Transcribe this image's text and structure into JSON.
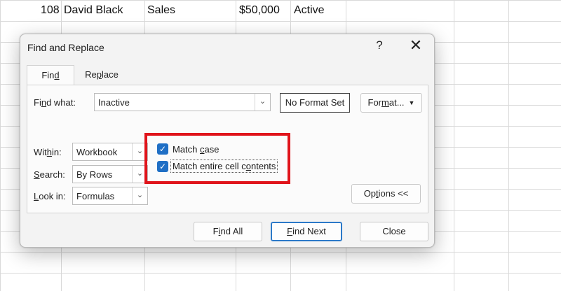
{
  "spreadsheet": {
    "row": {
      "id": "108",
      "name": "David Black",
      "department": "Sales",
      "salary": "$50,000",
      "status": "Active"
    }
  },
  "dialog": {
    "title": "Find and Replace",
    "help_label": "?",
    "close_label": "✕",
    "tabs": {
      "find": {
        "before": "Fin",
        "underline": "d",
        "after": ""
      },
      "replace": {
        "before": "Re",
        "underline": "p",
        "after": "lace"
      }
    },
    "find_what": {
      "label_before": "Fi",
      "label_underline": "n",
      "label_after": "d what:",
      "value": "Inactive"
    },
    "no_format_label": "No Format Set",
    "format_button": {
      "before": "For",
      "underline": "m",
      "after": "at..."
    },
    "within": {
      "label_before": "Wit",
      "label_underline": "h",
      "label_after": "in:",
      "value": "Workbook"
    },
    "search": {
      "label_before": "",
      "label_underline": "S",
      "label_after": "earch:",
      "value": "By Rows"
    },
    "look_in": {
      "label_before": "",
      "label_underline": "L",
      "label_after": "ook in:",
      "value": "Formulas"
    },
    "match_case": {
      "checked": true,
      "label_before": "Match ",
      "label_underline": "c",
      "label_after": "ase"
    },
    "match_entire": {
      "checked": true,
      "label_before": "Match entire cell c",
      "label_underline": "o",
      "label_after": "ntents"
    },
    "options_button": {
      "before": "Op",
      "underline": "t",
      "after": "ions <<"
    },
    "find_all_button": {
      "before": "F",
      "underline": "i",
      "after": "nd All"
    },
    "find_next_button": {
      "before": "",
      "underline": "F",
      "after": "ind Next"
    },
    "close_button": "Close"
  },
  "colors": {
    "highlight_border": "#e0141b",
    "checkbox_fill": "#1f6fc5",
    "primary_button_border": "#2b79c8"
  },
  "icons": {
    "checkbox_checked": "checkmark-icon",
    "dropdown": "chevron-down-icon",
    "close": "close-icon",
    "help": "help-icon"
  }
}
